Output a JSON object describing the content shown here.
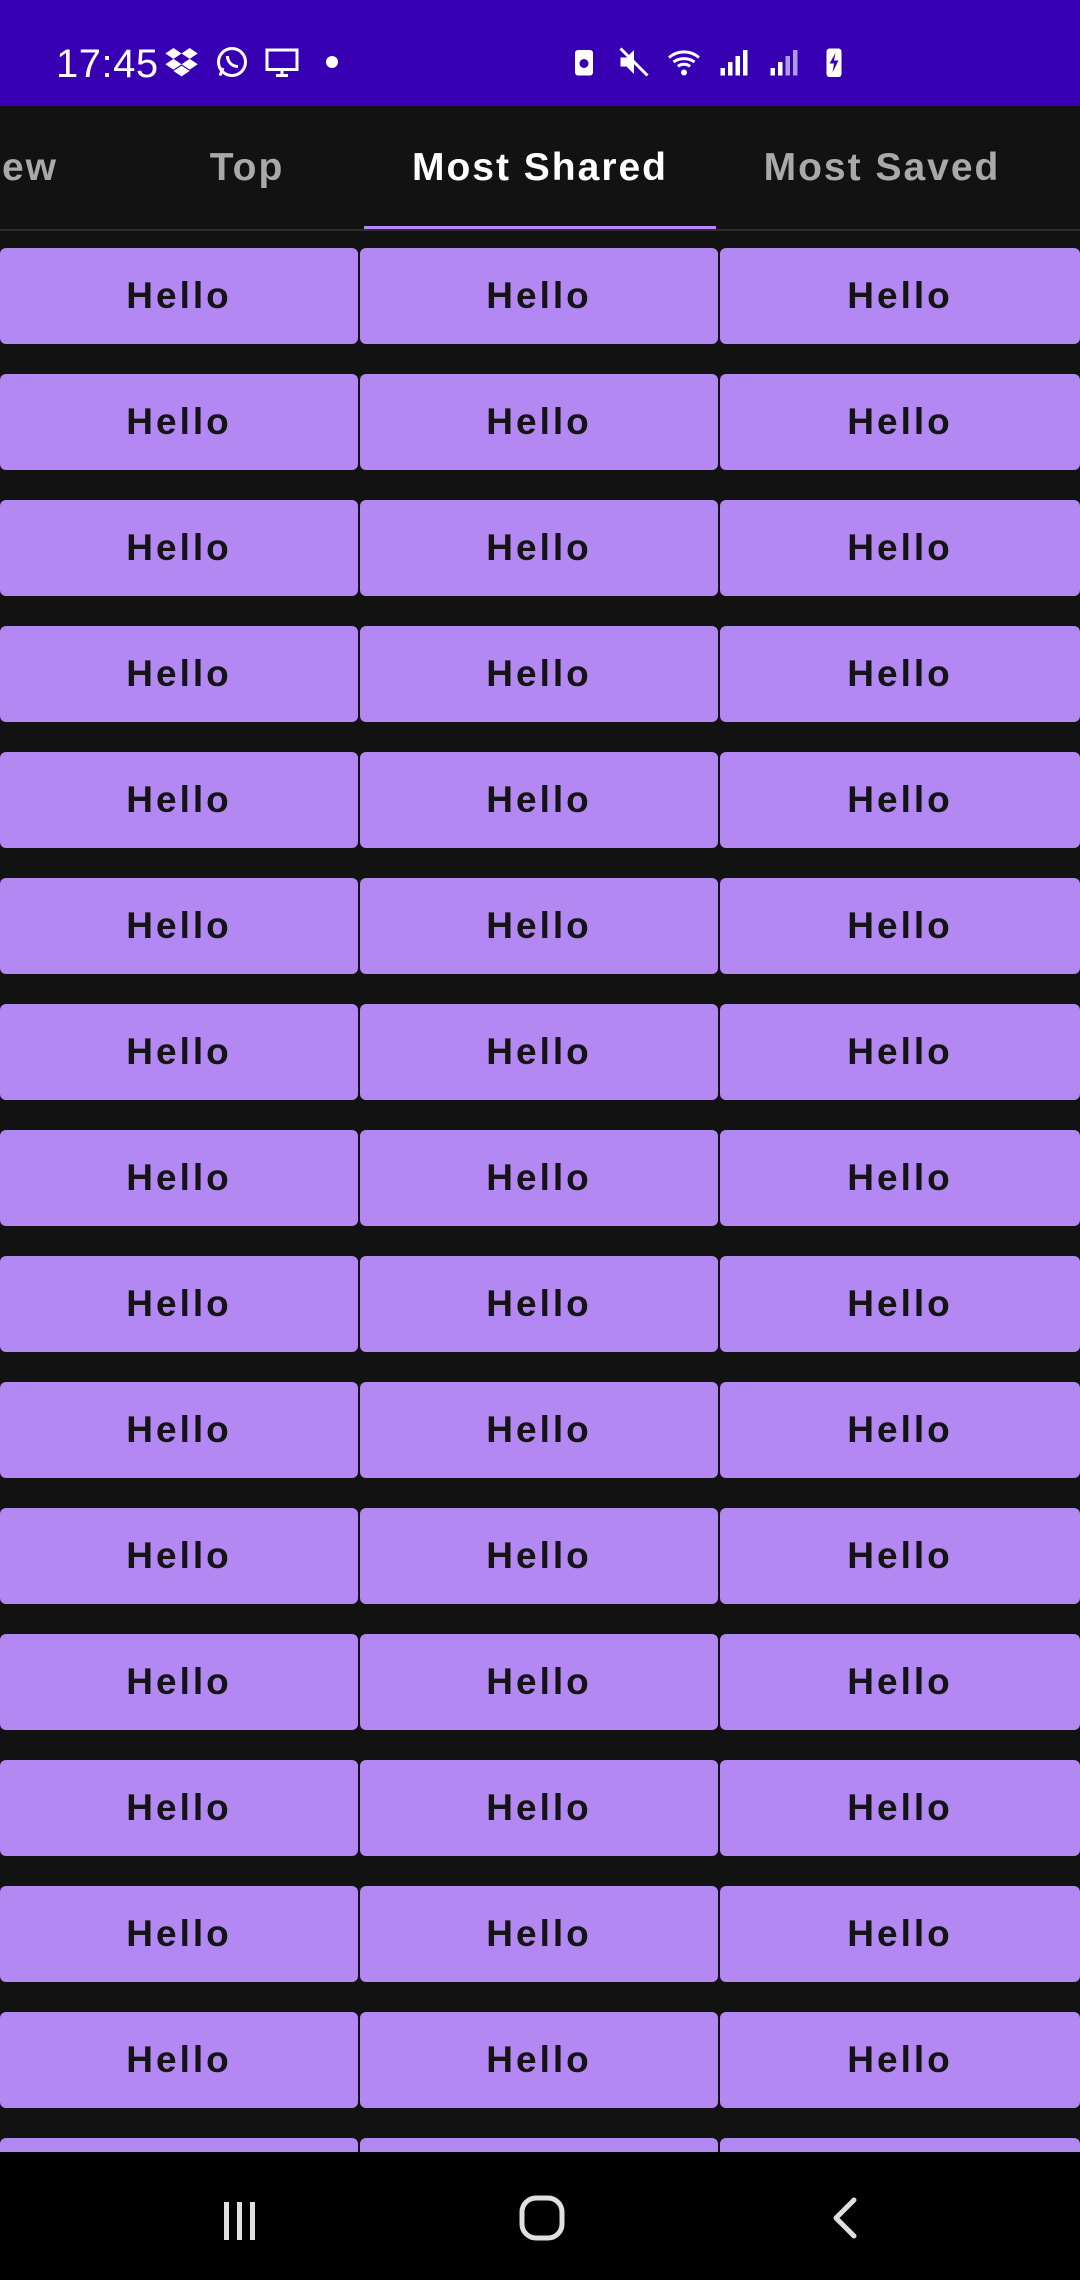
{
  "status_bar": {
    "time": "17:45",
    "left_icons": [
      "dropbox-icon",
      "whatsapp-icon",
      "cast-screen-icon",
      "dot-icon"
    ],
    "right_icons": [
      "battery-saver-icon",
      "mute-icon",
      "wifi-icon",
      "signal-icon",
      "signal-2-icon",
      "battery-charging-icon"
    ]
  },
  "tabs": [
    {
      "label": "ew"
    },
    {
      "label": "Top"
    },
    {
      "label": "Most Shared",
      "selected": true
    },
    {
      "label": "Most Saved"
    }
  ],
  "grid": {
    "columns": 3,
    "rows": [
      [
        "Hello",
        "Hello",
        "Hello"
      ],
      [
        "Hello",
        "Hello",
        "Hello"
      ],
      [
        "Hello",
        "Hello",
        "Hello"
      ],
      [
        "Hello",
        "Hello",
        "Hello"
      ],
      [
        "Hello",
        "Hello",
        "Hello"
      ],
      [
        "Hello",
        "Hello",
        "Hello"
      ],
      [
        "Hello",
        "Hello",
        "Hello"
      ],
      [
        "Hello",
        "Hello",
        "Hello"
      ],
      [
        "Hello",
        "Hello",
        "Hello"
      ],
      [
        "Hello",
        "Hello",
        "Hello"
      ],
      [
        "Hello",
        "Hello",
        "Hello"
      ],
      [
        "Hello",
        "Hello",
        "Hello"
      ],
      [
        "Hello",
        "Hello",
        "Hello"
      ],
      [
        "Hello",
        "Hello",
        "Hello"
      ],
      [
        "Hello",
        "Hello",
        "Hello"
      ],
      [
        "",
        "",
        ""
      ]
    ]
  },
  "nav_bar": {
    "icons": [
      "recents-icon",
      "home-icon",
      "back-icon"
    ]
  },
  "colors": {
    "status_bar": "#3700b3",
    "background": "#121212",
    "button": "#b388f2",
    "accent": "#bb86fc"
  }
}
